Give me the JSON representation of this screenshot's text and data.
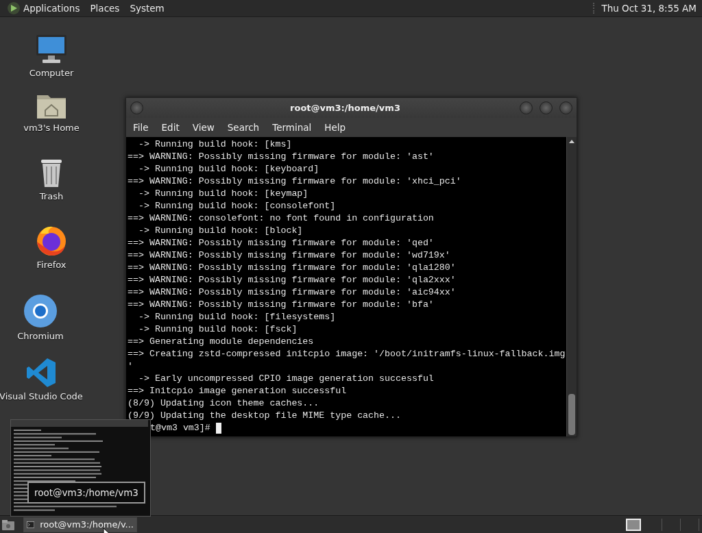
{
  "top_panel": {
    "menus": [
      {
        "label": "Applications"
      },
      {
        "label": "Places"
      },
      {
        "label": "System"
      }
    ],
    "clock": "Thu Oct 31,  8:55 AM"
  },
  "desktop_icons": [
    {
      "kind": "computer",
      "label": "Computer"
    },
    {
      "kind": "home",
      "label": "vm3's Home"
    },
    {
      "kind": "trash",
      "label": "Trash"
    },
    {
      "kind": "firefox",
      "label": "Firefox"
    },
    {
      "kind": "chromium",
      "label": "Chromium"
    },
    {
      "kind": "vscode",
      "label": "Visual Studio Code"
    }
  ],
  "terminal_window": {
    "title": "root@vm3:/home/vm3",
    "menu": [
      "File",
      "Edit",
      "View",
      "Search",
      "Terminal",
      "Help"
    ],
    "lines": [
      "  -> Running build hook: [kms]",
      "==> WARNING: Possibly missing firmware for module: 'ast'",
      "  -> Running build hook: [keyboard]",
      "==> WARNING: Possibly missing firmware for module: 'xhci_pci'",
      "  -> Running build hook: [keymap]",
      "  -> Running build hook: [consolefont]",
      "==> WARNING: consolefont: no font found in configuration",
      "  -> Running build hook: [block]",
      "==> WARNING: Possibly missing firmware for module: 'qed'",
      "==> WARNING: Possibly missing firmware for module: 'wd719x'",
      "==> WARNING: Possibly missing firmware for module: 'qla1280'",
      "==> WARNING: Possibly missing firmware for module: 'qla2xxx'",
      "==> WARNING: Possibly missing firmware for module: 'aic94xx'",
      "==> WARNING: Possibly missing firmware for module: 'bfa'",
      "  -> Running build hook: [filesystems]",
      "  -> Running build hook: [fsck]",
      "==> Generating module dependencies",
      "==> Creating zstd-compressed initcpio image: '/boot/initramfs-linux-fallback.img",
      "'",
      "  -> Early uncompressed CPIO image generation successful",
      "==> Initcpio image generation successful",
      "(8/9) Updating icon theme caches...",
      "(9/9) Updating the desktop file MIME type cache..."
    ],
    "prompt": "t@vm3 vm3]#"
  },
  "window_preview": {
    "tooltip": "root@vm3:/home/vm3"
  },
  "taskbar": {
    "tasks": [
      {
        "label": "root@vm3:/home/v...",
        "selected": true
      }
    ],
    "workspaces": [
      {
        "selected": true
      },
      {
        "selected": false
      },
      {
        "selected": false
      },
      {
        "selected": false
      }
    ]
  }
}
